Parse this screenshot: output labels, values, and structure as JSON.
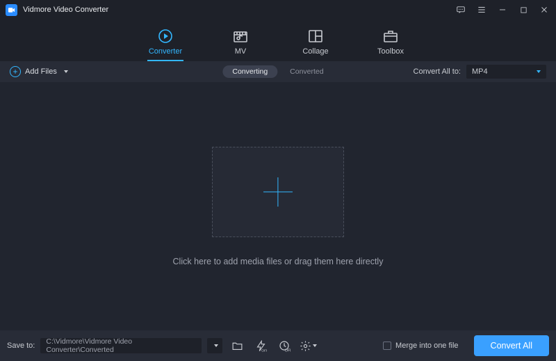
{
  "app": {
    "title": "Vidmore Video Converter"
  },
  "nav": {
    "items": [
      {
        "label": "Converter"
      },
      {
        "label": "MV"
      },
      {
        "label": "Collage"
      },
      {
        "label": "Toolbox"
      }
    ]
  },
  "toolbar": {
    "add_files_label": "Add Files",
    "mode_converting": "Converting",
    "mode_converted": "Converted",
    "convert_all_to_label": "Convert All to:",
    "format_selected": "MP4"
  },
  "main": {
    "drop_hint": "Click here to add media files or drag them here directly"
  },
  "bottom": {
    "save_to_label": "Save to:",
    "save_to_path": "C:\\Vidmore\\Vidmore Video Converter\\Converted",
    "merge_label": "Merge into one file",
    "convert_all_button": "Convert All"
  }
}
